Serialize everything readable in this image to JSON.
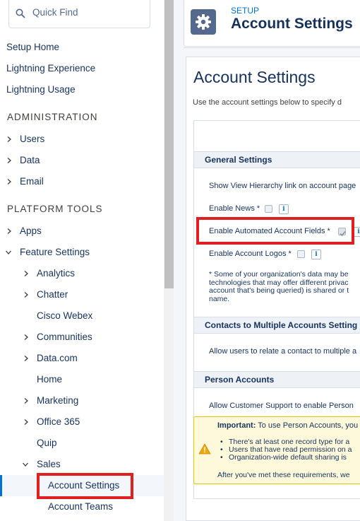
{
  "search": {
    "placeholder": "Quick Find"
  },
  "sidebar": {
    "top_items": [
      "Setup Home",
      "Lightning Experience",
      "Lightning Usage"
    ],
    "administration": {
      "heading": "ADMINISTRATION",
      "items": [
        "Users",
        "Data",
        "Email"
      ]
    },
    "platform_tools": {
      "heading": "PLATFORM TOOLS",
      "apps": "Apps",
      "feature_settings": "Feature Settings",
      "feature_children": [
        "Analytics",
        "Chatter",
        "Cisco Webex",
        "Communities",
        "Data.com",
        "Home",
        "Marketing",
        "Office 365",
        "Quip",
        "Sales"
      ],
      "sales_children": [
        "Account Settings",
        "Account Teams"
      ]
    }
  },
  "header": {
    "section": "SETUP",
    "title": "Account Settings",
    "icon": "gear-icon"
  },
  "main": {
    "title": "Account Settings",
    "description": "Use the account settings below to specify d",
    "general": {
      "heading": "General Settings",
      "view_hierarchy": "Show View Hierarchy link on account page",
      "enable_news": "Enable News *",
      "enable_automated_fields": "Enable Automated Account Fields *",
      "enable_logos": "Enable Account Logos *",
      "note": "* Some of your organization's data may be technologies that may offer different privac account that's being queried) is shared or t name."
    },
    "contacts": {
      "heading": "Contacts to Multiple Accounts Setting",
      "text": "Allow users to relate a contact to multiple a"
    },
    "person_accounts": {
      "heading": "Person Accounts",
      "text": "Allow Customer Support to enable Person",
      "warning_label": "Important:",
      "warning_text": "To use Person Accounts, you",
      "warning_items": [
        "There's at least one record type for a",
        "Users that have read permission on a",
        "Organization-wide default sharing is"
      ],
      "warning_after": "After you've met these requirements, we"
    }
  },
  "colors": {
    "accent": "#0070d2",
    "highlight": "#e02020",
    "warning_bg": "#fff9db"
  }
}
